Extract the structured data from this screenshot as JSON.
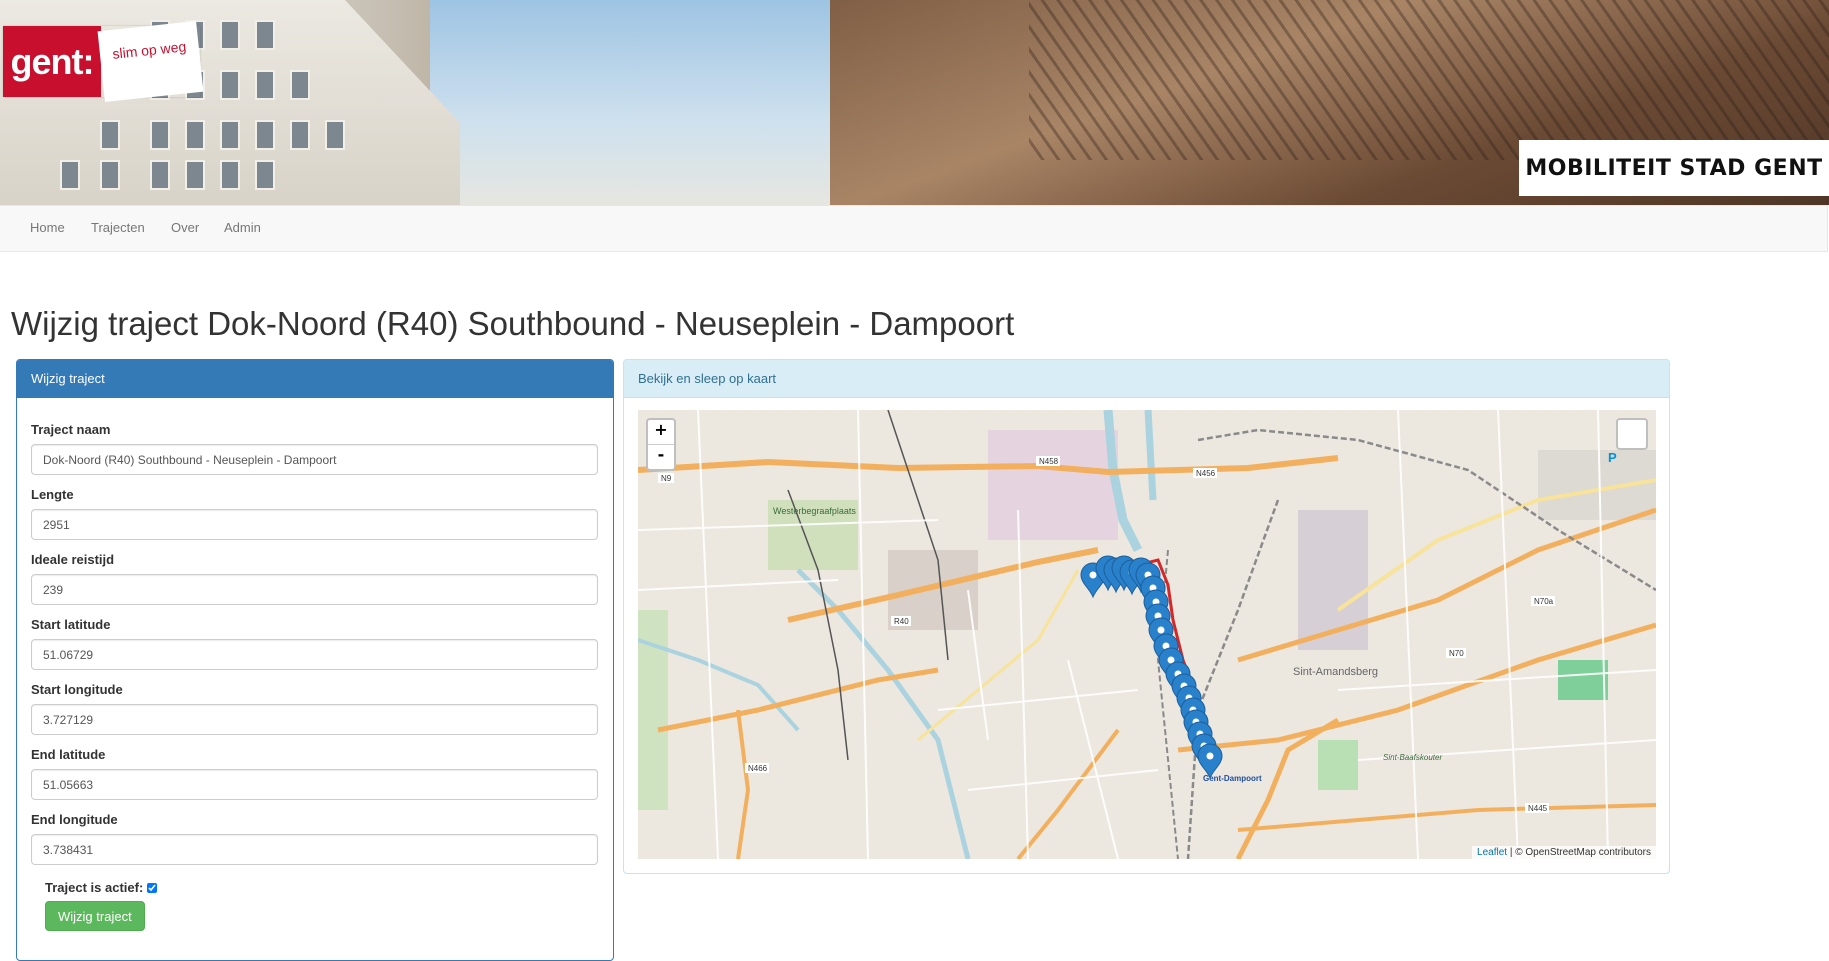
{
  "banner": {
    "logo_text": "gent:",
    "logo_slogan": "slim op weg",
    "brand": "MOBILITEIT STAD GENT"
  },
  "nav": {
    "items": [
      {
        "label": "Home"
      },
      {
        "label": "Trajecten"
      },
      {
        "label": "Over"
      },
      {
        "label": "Admin"
      }
    ]
  },
  "page": {
    "title": "Wijzig traject Dok-Noord (R40) Southbound - Neuseplein - Dampoort"
  },
  "form_panel": {
    "heading": "Wijzig traject",
    "fields": [
      {
        "label": "Traject naam",
        "value": "Dok-Noord (R40) Southbound - Neuseplein - Dampoort"
      },
      {
        "label": "Lengte",
        "value": "2951"
      },
      {
        "label": "Ideale reistijd",
        "value": "239"
      },
      {
        "label": "Start latitude",
        "value": "51.06729"
      },
      {
        "label": "Start longitude",
        "value": "3.727129"
      },
      {
        "label": "End latitude",
        "value": "51.05663"
      },
      {
        "label": "End longitude",
        "value": "3.738431"
      }
    ],
    "active_label": "Traject is actief:",
    "active_checked": true,
    "submit_label": "Wijzig traject"
  },
  "map_panel": {
    "heading": "Bekijk en sleep op kaart",
    "zoom_in": "+",
    "zoom_out": "-",
    "attribution_link": "Leaflet",
    "attribution_text": " | © OpenStreetMap contributors",
    "labels": {
      "cemetery": "Westerbegraafplaats",
      "district": "Sint-Amandsberg",
      "station": "Gent-Dampoort",
      "park": "Sint-Baafskouter",
      "parking": "P",
      "roads": [
        "N9",
        "N458",
        "N456",
        "N70",
        "R40",
        "N466",
        "N445",
        "N70a"
      ]
    },
    "colors": {
      "marker": "#2a81cb",
      "route": "#d62728",
      "orange_road": "#f2b05e"
    }
  }
}
